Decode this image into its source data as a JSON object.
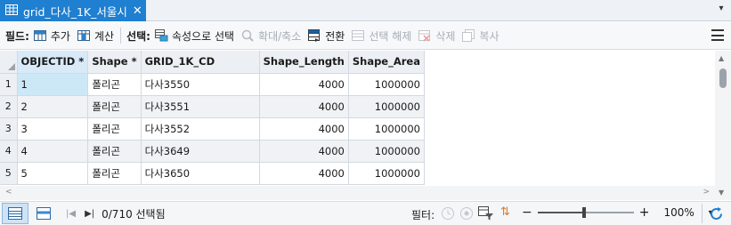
{
  "tab": {
    "title": "grid_다사_1K_서울시",
    "close": "✕",
    "dropdown": "▾"
  },
  "toolbar": {
    "fields_label": "필드:",
    "add_label": "추가",
    "calculate_label": "계산",
    "selection_label": "선택:",
    "select_by_attr_label": "속성으로 선택",
    "zoom_to_label": "확대/축소",
    "switch_label": "전환",
    "clear_label": "선택 해제",
    "delete_label": "삭제",
    "copy_label": "복사"
  },
  "grid": {
    "columns": [
      "OBJECTID *",
      "Shape *",
      "GRID_1K_CD",
      "Shape_Length",
      "Shape_Area"
    ],
    "rows": [
      {
        "rownum": "1",
        "objectid": "1",
        "shape": "폴리곤",
        "grid_cd": "다사3550",
        "length": "4000",
        "area": "1000000"
      },
      {
        "rownum": "2",
        "objectid": "2",
        "shape": "폴리곤",
        "grid_cd": "다사3551",
        "length": "4000",
        "area": "1000000"
      },
      {
        "rownum": "3",
        "objectid": "3",
        "shape": "폴리곤",
        "grid_cd": "다사3552",
        "length": "4000",
        "area": "1000000"
      },
      {
        "rownum": "4",
        "objectid": "4",
        "shape": "폴리곤",
        "grid_cd": "다사3649",
        "length": "4000",
        "area": "1000000"
      },
      {
        "rownum": "5",
        "objectid": "5",
        "shape": "폴리곤",
        "grid_cd": "다사3650",
        "length": "4000",
        "area": "1000000"
      }
    ]
  },
  "status": {
    "selected_count": "0/710 선택됨",
    "filter_label": "필터:",
    "zoom_minus": "−",
    "zoom_plus": "+",
    "zoom_value": "100%",
    "zoom_dropdown": "▾",
    "zoom_slider_fraction": 0.48
  },
  "colors": {
    "accent": "#1f7fd0",
    "selection": "#cce8f6"
  }
}
